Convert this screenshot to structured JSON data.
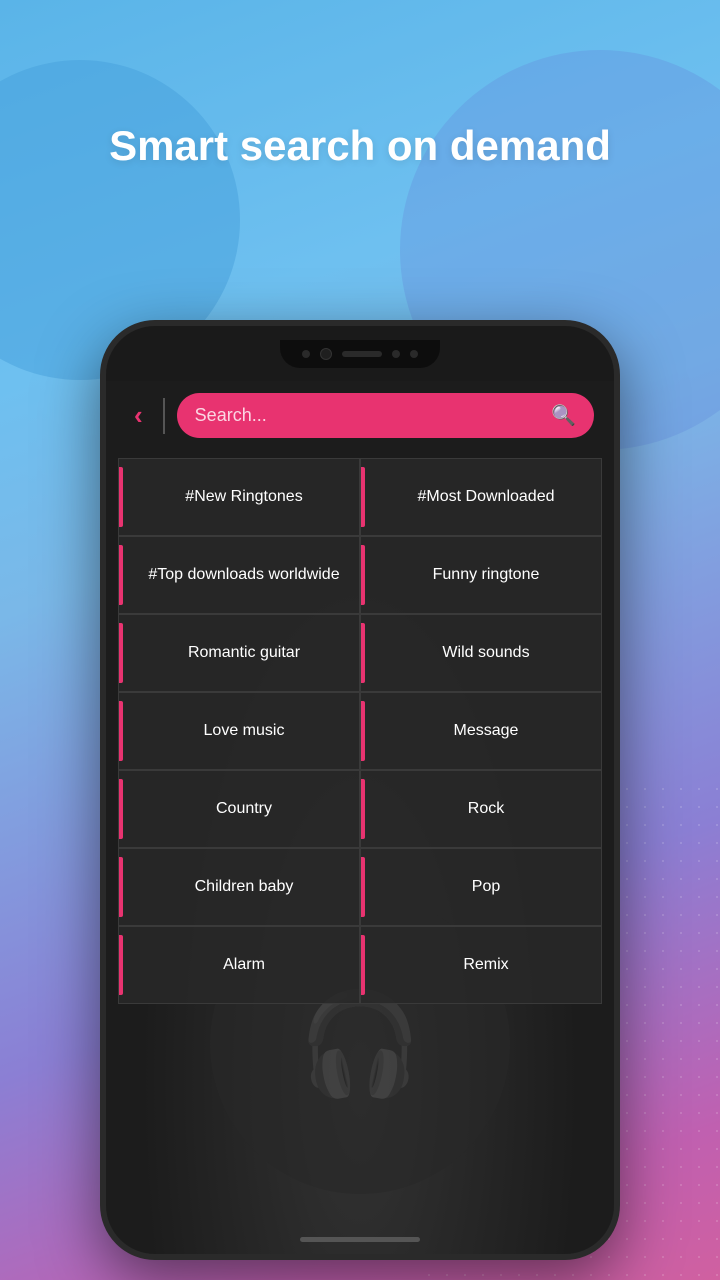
{
  "background": {
    "headline": "Smart search on demand"
  },
  "phone": {
    "searchbar": {
      "placeholder": "Search..."
    },
    "categories": [
      {
        "id": "new-ringtones",
        "label": "#New Ringtones"
      },
      {
        "id": "most-downloaded",
        "label": "#Most Downloaded"
      },
      {
        "id": "top-downloads",
        "label": "#Top downloads worldwide"
      },
      {
        "id": "funny-ringtone",
        "label": "Funny ringtone"
      },
      {
        "id": "romantic-guitar",
        "label": "Romantic guitar"
      },
      {
        "id": "wild-sounds",
        "label": "Wild sounds"
      },
      {
        "id": "love-music",
        "label": "Love music"
      },
      {
        "id": "message",
        "label": "Message"
      },
      {
        "id": "country",
        "label": "Country"
      },
      {
        "id": "rock",
        "label": "Rock"
      },
      {
        "id": "children-baby",
        "label": "Children baby"
      },
      {
        "id": "pop",
        "label": "Pop"
      },
      {
        "id": "alarm",
        "label": "Alarm"
      },
      {
        "id": "remix",
        "label": "Remix"
      }
    ]
  },
  "icons": {
    "back": "‹",
    "search": "🔍"
  }
}
